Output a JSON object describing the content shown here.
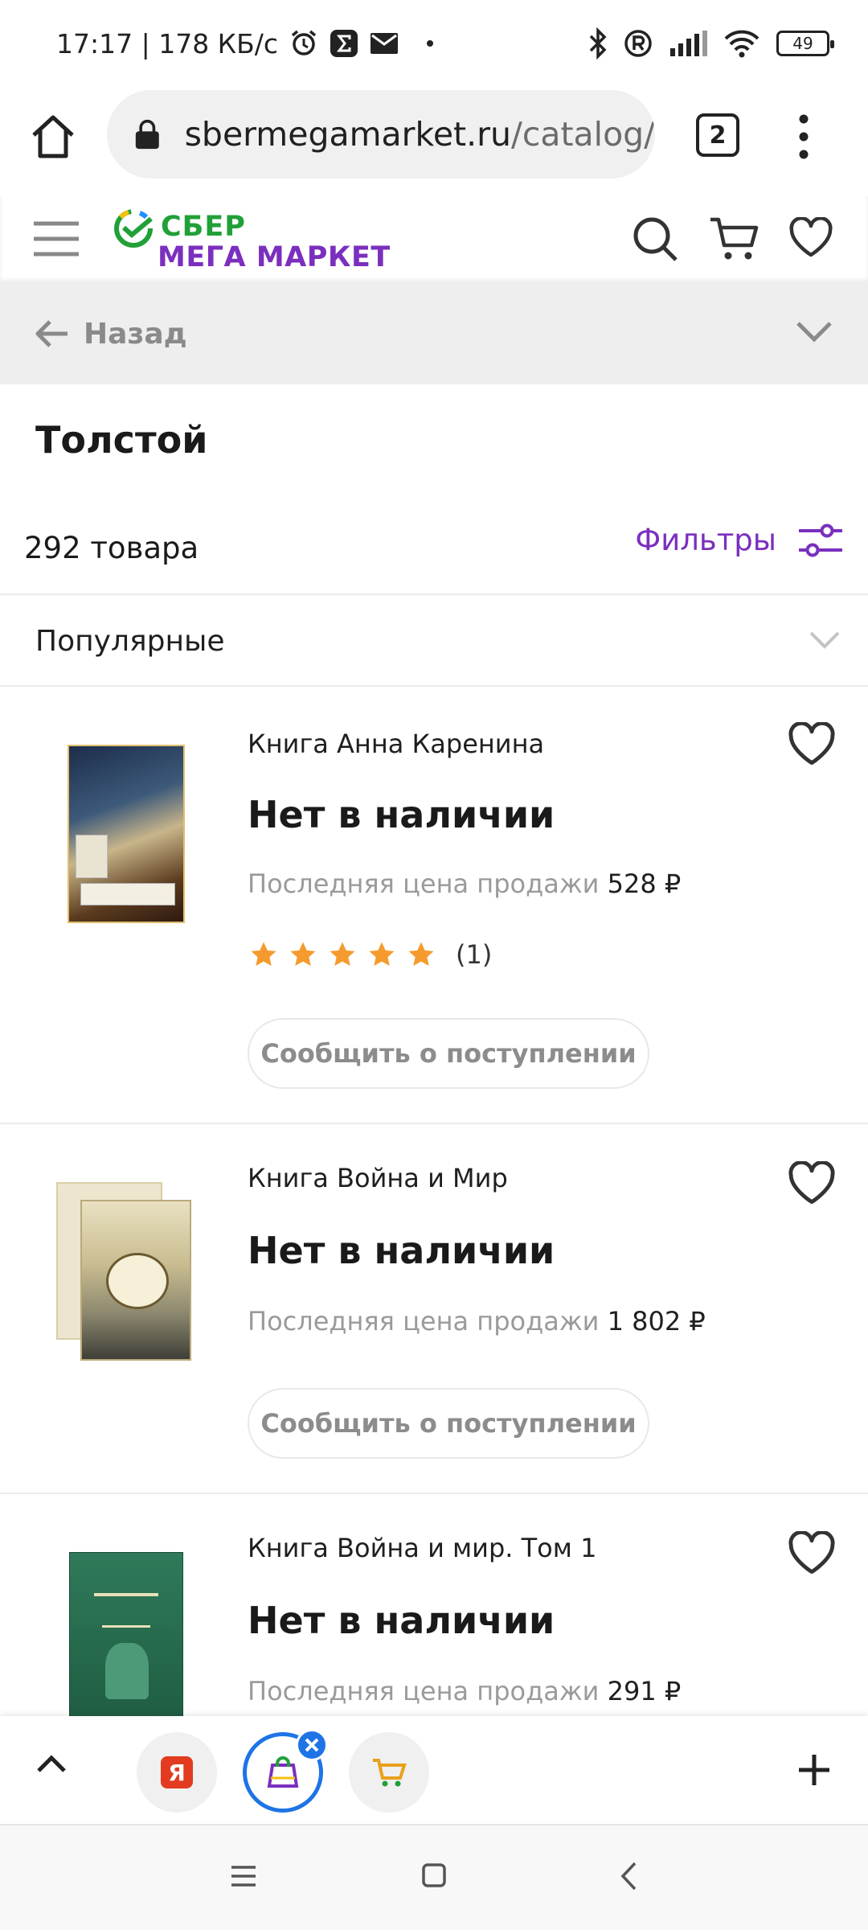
{
  "status_bar": {
    "time_speed": "17:17 | 178 КБ/с",
    "battery": "49",
    "icons": [
      "alarm-icon",
      "sigma-app-icon",
      "mail-icon",
      "dot-icon",
      "bluetooth-icon",
      "registered-icon",
      "signal-icon",
      "wifi-icon",
      "battery-icon"
    ]
  },
  "browser": {
    "url_domain": "sbermegamarket.ru",
    "url_path": "/catalog/",
    "tab_count": "2"
  },
  "site": {
    "logo_line1": "СБЕР",
    "logo_line2": "МЕГА МАРКЕТ",
    "colors": {
      "brand_green": "#21a038",
      "brand_purple": "#7b2fbe",
      "star": "#f59b2e"
    }
  },
  "back": {
    "label": "Назад"
  },
  "catalog": {
    "title": "Толстой",
    "count": "292 товара",
    "filters_label": "Фильтры",
    "sort_label": "Популярные"
  },
  "products": [
    {
      "name": "Книга Анна Каренина",
      "status": "Нет в наличии",
      "price_label": "Последняя цена продажи",
      "price": "528 ₽",
      "rating": 5,
      "reviews": "(1)",
      "notify": "Сообщить о поступлении"
    },
    {
      "name": "Книга Война и Мир",
      "status": "Нет в наличии",
      "price_label": "Последняя цена продажи",
      "price": "1 802 ₽",
      "notify": "Сообщить о поступлении"
    },
    {
      "name": "Книга Война и мир. Том 1",
      "status": "Нет в наличии",
      "price_label": "Последняя цена продажи",
      "price": "291 ₽"
    }
  ],
  "tabstrip": {
    "yandex_letter": "Я"
  }
}
